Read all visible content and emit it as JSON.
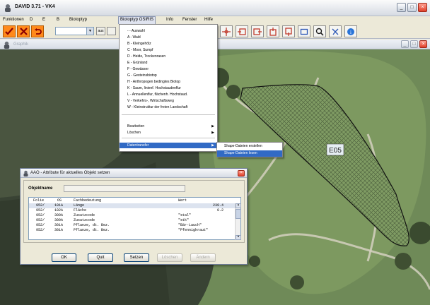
{
  "window": {
    "title": "DAVID 3.71 - VK4"
  },
  "menubar": {
    "items": [
      "Funktionen",
      "D",
      "E",
      "B",
      "Biotoptyp",
      "Biotoptyp OSIRIS",
      "Info",
      "Fenster",
      "Hilfe"
    ]
  },
  "toolbar": {
    "combo_value": "",
    "small_label": "aus"
  },
  "graphik": {
    "title": "Graphik"
  },
  "map": {
    "polygon_label": "E05"
  },
  "dropdown": {
    "items": [
      "- - Auswahl",
      "A - Wald",
      "B - Kleingehölz",
      "C - Moor, Sumpf",
      "D - Heide, Trockenrasen",
      "E - Grünland",
      "F - Gewässer",
      "G - Gesteinsbiotop",
      "H - Anthropogen bedingtes Biotop",
      "K - Saum, linienf. Hochstaudenflur",
      "L - Annuellenflur, flächenh. Hochstaud.",
      "V - Verkehrs-, Wirtschaftsweg",
      "W - Kleinstruktur der freien Landschaft"
    ],
    "bearbeiten": "Bearbeiten",
    "loeschen": "Löschen",
    "datentransfer": "Datentransfer"
  },
  "submenu": {
    "items": [
      "Shape-Dateien erstellen",
      "Shape-Dateien lesen"
    ]
  },
  "dialog": {
    "title": "AAO - Attribute für aktuelles Objekt setzen",
    "objektname_label": "Objektname",
    "objektname_value": "",
    "columns": [
      "Folie",
      "OS",
      "Fachbedeutung",
      "Wert"
    ],
    "rows": [
      [
        "952/",
        "101A",
        "Länge",
        "239.4"
      ],
      [
        "952/",
        "102A",
        "Fläche",
        "0.2"
      ],
      [
        "952/",
        "300A",
        "Zusatzcode",
        "\"stal\""
      ],
      [
        "952/",
        "300A",
        "Zusatzcode",
        "\"stk\""
      ],
      [
        "952/",
        "301A",
        "Pflanze, dt. Bez.",
        "\"Bär-Lauch\""
      ],
      [
        "952/",
        "301A",
        "Pflanze, dt. Bez.",
        "\"Pfennigkraut\""
      ]
    ],
    "buttons": {
      "ok": "OK",
      "quit": "Quit",
      "setzen": "Setzen",
      "loeschen": "Löschen",
      "aendern": "Ändern"
    }
  },
  "colors": {
    "highlight": "#316ac5",
    "toolbar_accent": "#ff8a1a",
    "titlebar_close": "#e0402a"
  }
}
